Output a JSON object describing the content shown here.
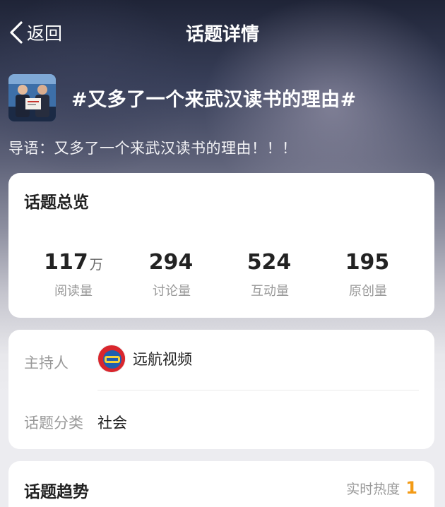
{
  "nav": {
    "back_label": "返回",
    "title": "话题详情"
  },
  "topic": {
    "title": "#又多了一个来武汉读书的理由#",
    "intro": "导语：又多了一个来武汉读书的理由！！！"
  },
  "overview": {
    "title": "话题总览",
    "stats": [
      {
        "value": "117",
        "unit": "万",
        "label": "阅读量"
      },
      {
        "value": "294",
        "unit": "",
        "label": "讨论量"
      },
      {
        "value": "524",
        "unit": "",
        "label": "互动量"
      },
      {
        "value": "195",
        "unit": "",
        "label": "原创量"
      }
    ]
  },
  "info": {
    "host_label": "主持人",
    "host_name": "远航视频",
    "category_label": "话题分类",
    "category_value": "社会"
  },
  "trend": {
    "title": "话题趋势",
    "heat_label": "实时热度",
    "heat_value": "1"
  },
  "colors": {
    "accent": "#f39b16",
    "host_avatar": "#d9262d"
  }
}
